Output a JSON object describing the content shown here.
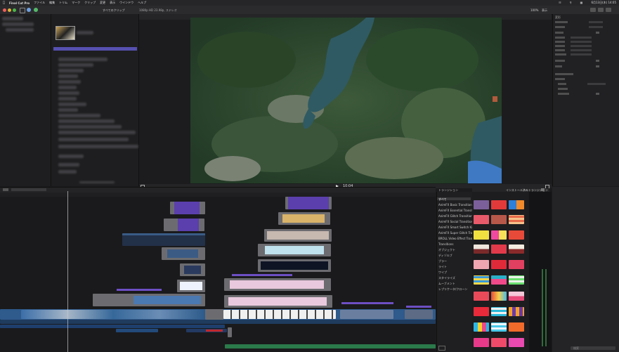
{
  "menubar": {
    "app": "Final Cut Pro",
    "items": [
      "ファイル",
      "編集",
      "トリム",
      "マーク",
      "クリップ",
      "変更",
      "表示",
      "ウインドウ",
      "ヘルプ"
    ],
    "clock": "6月13日(木) 14:05"
  },
  "toolbar": {
    "browser_filter": "すべてのクリップ",
    "viewer_format": "1080p HD 23.98p, ステレオ",
    "zoom": "100%",
    "view": "表示"
  },
  "timeline": {
    "timecode": "10:04"
  },
  "transitions": {
    "header": "トランジション",
    "browser_title": "インストール済みトランジション",
    "categories": [
      "すべて",
      "AnimFX Basic Transitions Free",
      "AnimFX Essential Transitions",
      "AnimFX Glitch Transitions",
      "AnimFX Social Transitions",
      "AnimFX Smart Switch Kit",
      "AnimFX Super Glitch Transitions",
      "BROLL Video Effect Transitions",
      "Transitions",
      "オブジェクト",
      "ディゾルブ",
      "ブラー",
      "ライト",
      "ワイプ",
      "スタイライズ",
      "ムーブメント",
      "レプリケータ/クローン"
    ],
    "search_placeholder": "検索"
  },
  "inspector": {
    "section_title": "変形"
  },
  "icons": [
    "apple-icon",
    "wifi-icon",
    "search-icon",
    "control-center-icon",
    "play-icon",
    "settings-icon"
  ]
}
